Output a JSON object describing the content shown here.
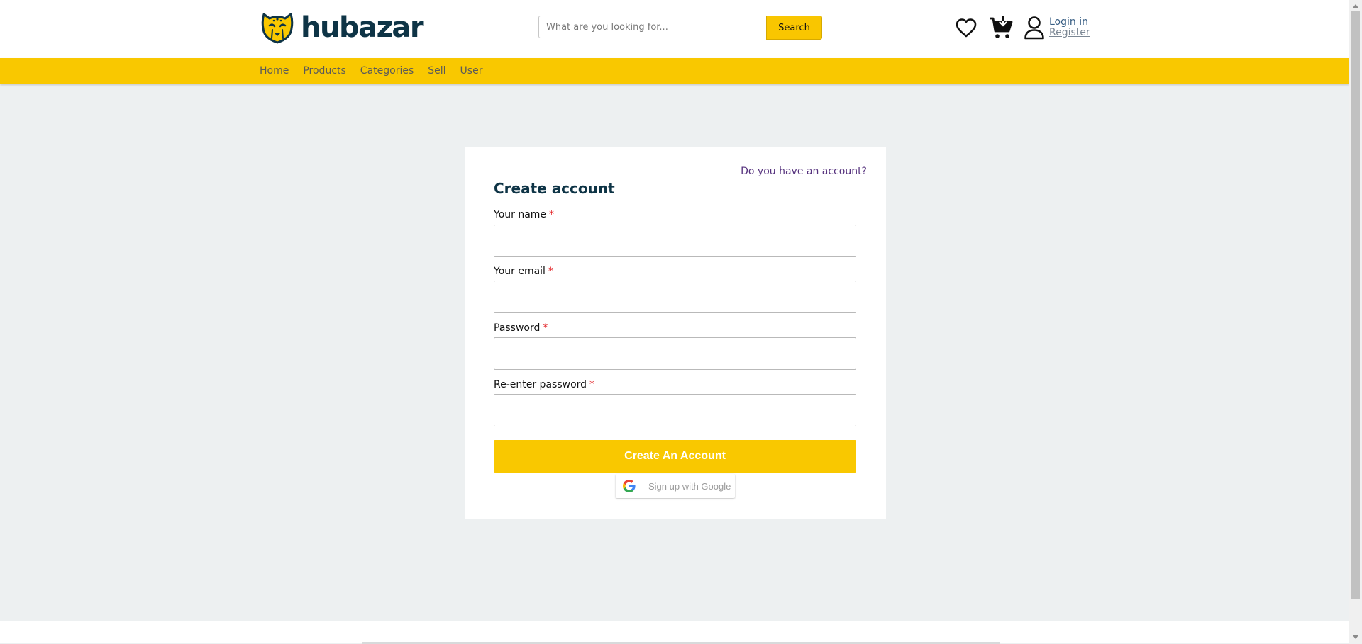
{
  "brand": {
    "name": "hubazar",
    "logo_icon": "cheetah-icon",
    "accent_color": "#f9c800",
    "text_color": "#0e3446"
  },
  "search": {
    "placeholder": "What are you looking for...",
    "value": "",
    "button_label": "Search"
  },
  "header_icons": [
    "heart-icon",
    "cart-icon",
    "user-icon"
  ],
  "auth": {
    "login_label": "Login in",
    "register_label": "Register"
  },
  "nav": {
    "items": [
      {
        "label": "Home"
      },
      {
        "label": "Products"
      },
      {
        "label": "Categories"
      },
      {
        "label": "Sell"
      },
      {
        "label": "User"
      }
    ]
  },
  "form": {
    "have_account_link": "Do you have an account?",
    "title": "Create account",
    "required_mark": "*",
    "fields": [
      {
        "label": "Your name",
        "value": ""
      },
      {
        "label": "Your email",
        "value": ""
      },
      {
        "label": "Password",
        "value": ""
      },
      {
        "label": "Re-enter password",
        "value": ""
      }
    ],
    "submit_label": "Create An Account",
    "google_label": "Sign up with Google",
    "google_icon": "google-icon"
  }
}
